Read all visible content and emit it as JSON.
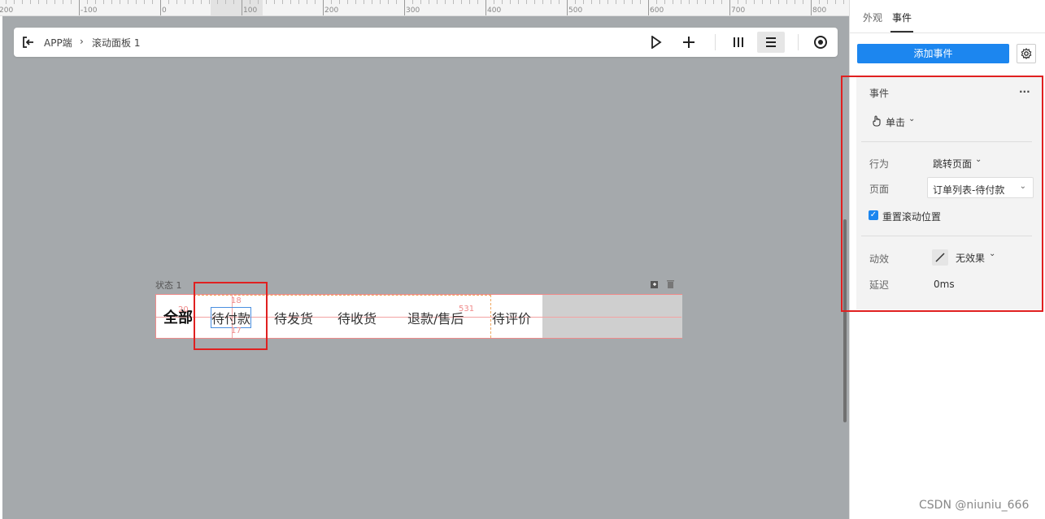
{
  "ruler": {
    "labels": [
      "200",
      "-100",
      "0",
      "100",
      "200",
      "300",
      "400",
      "500",
      "600",
      "700",
      "800"
    ]
  },
  "toolbar": {
    "breadcrumb_root": "APP端",
    "breadcrumb_sep": "›",
    "breadcrumb_current": "滚动面板 1",
    "icons": [
      "exit-icon",
      "play-icon",
      "plus-icon",
      "columns-icon",
      "menu-icon",
      "target-icon"
    ]
  },
  "canvas": {
    "state_label": "状态 1",
    "tabs": [
      "全部",
      "待付款",
      "待发货",
      "待收货",
      "退款/售后",
      "待评价"
    ],
    "measures": {
      "top": "18",
      "bottom": "17",
      "left": "20",
      "right": "531"
    }
  },
  "panel": {
    "tabs": [
      "外观",
      "事件"
    ],
    "active_tab": "事件",
    "add_button": "添加事件",
    "event": {
      "title": "事件",
      "more": "...",
      "trigger": "单击",
      "action_label": "行为",
      "action_value": "跳转页面",
      "page_label": "页面",
      "page_value": "订单列表-待付款",
      "reset_scroll_label": "重置滚动位置",
      "reset_scroll_checked": true,
      "effect_label": "动效",
      "effect_value": "无效果",
      "delay_label": "延迟",
      "delay_value": "0ms"
    }
  },
  "watermark": "CSDN @niuniu_666",
  "colors": {
    "accent": "#1c86ef",
    "highlight": "#e02020",
    "canvas_bg": "#a5a9ac"
  }
}
